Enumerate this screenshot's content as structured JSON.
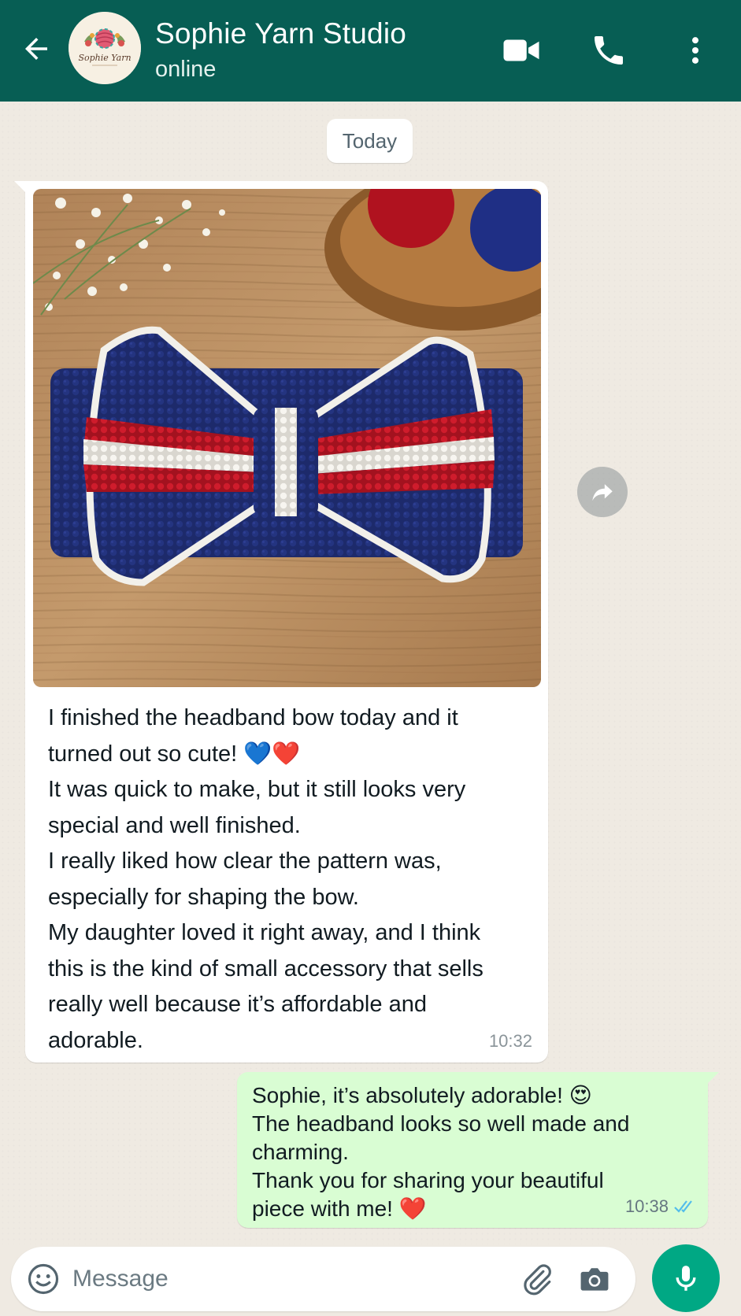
{
  "colors": {
    "header": "#075e54",
    "outgoing_bubble": "#d9fdd3",
    "incoming_bubble": "#ffffff",
    "chat_bg": "#efeae2",
    "mic_button": "#00a884",
    "read_ticks": "#53bdeb"
  },
  "header": {
    "back_icon": "arrow-left-icon",
    "avatar_text": "Sophie Yarn",
    "contact_name": "Sophie Yarn Studio",
    "status": "online",
    "icons": [
      "video-call-icon",
      "phone-icon",
      "more-vert-icon"
    ]
  },
  "chat": {
    "date_separator": "Today",
    "incoming": {
      "image_subject": "crochet-headband-bow-photo",
      "paragraphs": [
        "I finished the headband bow today and it turned out so cute! 💙❤️",
        "It was quick to make, but it still looks very special and well finished.",
        "I really liked how clear the pattern was, especially for shaping the bow.",
        "My daughter loved it right away, and I think this is the kind of small accessory that sells really well because it’s affordable and adorable."
      ],
      "time": "10:32"
    },
    "forward_icon": "forward-icon",
    "outgoing": {
      "lines": [
        "Sophie, it’s absolutely adorable! 😍",
        "The headband looks so well made and charming.",
        "Thank you for sharing your beautiful piece with me! ❤️"
      ],
      "time": "10:38",
      "status_icon": "double-check-read-icon"
    }
  },
  "input": {
    "placeholder": "Message",
    "value": "",
    "icons": [
      "emoji-icon",
      "paperclip-icon",
      "camera-icon",
      "mic-icon"
    ]
  }
}
